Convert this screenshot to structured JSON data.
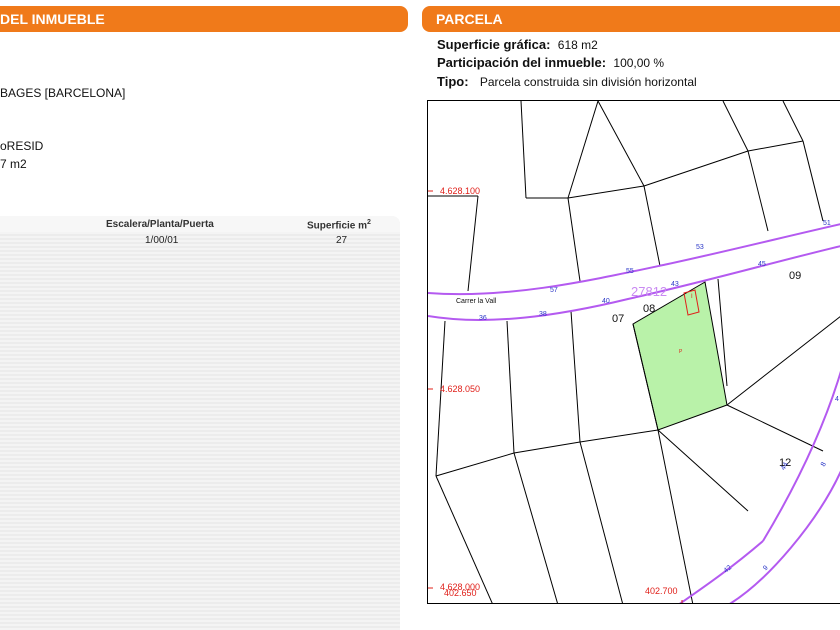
{
  "left": {
    "header": "DEL INMUEBLE",
    "address_tail": "BAGES [BARCELONA]",
    "use_tail": "oRESID",
    "surface_tail": "7 m2",
    "table": {
      "col_escalera": "Escalera/Planta/Puerta",
      "col_superficie": "Superficie m",
      "col_superficie_sup": "2",
      "rows": [
        {
          "escalera": "1/00/01",
          "superficie": "27"
        }
      ]
    }
  },
  "parcela": {
    "header": "PARCELA",
    "superficie_label": "Superficie gráfica:",
    "superficie_value": "618 m2",
    "participacion_label": "Participación del inmueble:",
    "participacion_value": "100,00 %",
    "tipo_label": "Tipo:",
    "tipo_value": "Parcela construida sin división horizontal"
  },
  "map": {
    "street_name": "Carrer la Vall",
    "block_number": "27812",
    "parcel_labels": [
      "07",
      "08",
      "09",
      "12"
    ],
    "building_letter": "I",
    "parcel_letter": "P",
    "number_labels": [
      "57",
      "55",
      "53",
      "51",
      "45",
      "43",
      "40",
      "38",
      "36",
      "44",
      "42",
      "9",
      "8",
      "4"
    ],
    "coord_labels": [
      "4.628.100",
      "4.628.050",
      "4.628.000",
      "402.650",
      "402.700"
    ],
    "colors": {
      "parcel_fill": "#b9f2a9",
      "street": "#b45af0",
      "coords": "#e0201a",
      "numbers": "#2c38c8",
      "building": "#e0201a"
    }
  }
}
